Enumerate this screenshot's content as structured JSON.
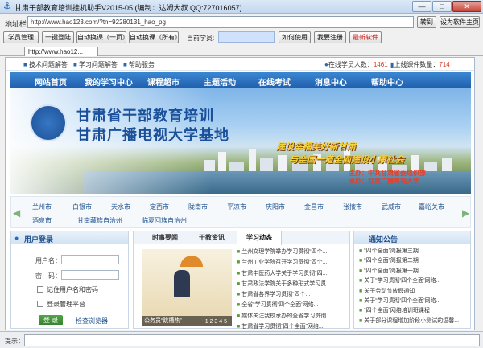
{
  "window": {
    "title": "甘肃干部教育培训挂机助手V2015-05 (编制：达姆大叔 QQ:727016057)",
    "minimize": "—",
    "maximize": "□",
    "close": "✕"
  },
  "address": {
    "label": "地址栏:",
    "value": "http://www.hao123.com/?tn=92280131_hao_pg",
    "go_button": "转到",
    "home_button": "设为软件主页"
  },
  "toolbar": {
    "student_mgmt": "学员管理",
    "one_click_login": "一键登陆",
    "auto_switch_page": "自动换课（一页）",
    "auto_switch_all": "自动换课（所有）",
    "current_student_label": "当前学员:",
    "current_student_value": "",
    "how_to_use": "如何使用",
    "register": "我要注册",
    "latest_software": "最新软件"
  },
  "tabs": [
    {
      "label": "http://www.hao12..."
    }
  ],
  "site": {
    "topline": {
      "links": [
        {
          "icon": "■",
          "label": "技术问题解答"
        },
        {
          "icon": "■",
          "label": "学习问题解答"
        },
        {
          "icon": "■",
          "label": "帮助服务"
        }
      ],
      "online_label": "在线学员人数：",
      "online_count": "1461",
      "courses_label": "上线课件数量：",
      "courses_count": "714"
    },
    "nav": [
      "网站首页",
      "我的学习中心",
      "课程超市",
      "主题活动",
      "在线考试",
      "消息中心",
      "帮助中心"
    ],
    "banner": {
      "title1": "甘肃省干部教育培训",
      "title2": "甘肃广播电视大学基地",
      "slogan1": "建设幸福美好新甘肃",
      "slogan2": "与全国一道全面建设小康社会",
      "host1": "主办：中共甘肃省委组织部",
      "host2": "承办：甘肃广播电视大学"
    },
    "cities_row1": [
      "兰州市",
      "白银市",
      "天水市",
      "定西市",
      "陇南市",
      "平凉市",
      "庆阳市",
      "金昌市",
      "张掖市",
      "武威市",
      "嘉峪关市"
    ],
    "cities_row2": [
      "酒泉市",
      "甘南藏族自治州",
      "临夏回族自治州"
    ],
    "login": {
      "title": "用户登录",
      "username_label": "用户名：",
      "password_label": "密　码：",
      "remember": "记住用户名和密码",
      "admin": "登录管理平台",
      "login_button": "登 录",
      "browser_check": "检查浏览器"
    },
    "news": {
      "tabs": [
        "时事要闻",
        "干教资讯",
        "学习动态"
      ],
      "active_tab": 2,
      "photo_caption": "公务员“跳槽热”",
      "photo_pager": "1 2 3 4 5",
      "items": [
        "兰州文理学院举办学习贯彻“四个...",
        "兰州工业学院召开学习贯彻“四个...",
        "甘肃中医药大学关于学习贯彻“四...",
        "甘肃政法学院关于多种形式学习贯...",
        "甘肃省各界学习贯彻“四个...",
        "全省“学习贯彻‘四个全面’网络...",
        "媒体关注我校承办的全省学习贯彻...",
        "甘肃省学习贯彻“四个全面”网络..."
      ]
    },
    "notice": {
      "title": "通知公告",
      "items": [
        "“四个全面”简报第三期",
        "“四个全面”简报第二期",
        "“四个全面”简报第一期",
        "关于“学习贯彻‘四个全面’网络...",
        "关于劳动节放假通知",
        "关于“学习贯彻‘四个全面’网络...",
        "“四个全面”网络培训班课程",
        "关于部分课程增加阶段小测试的温馨..."
      ]
    }
  },
  "status": {
    "label": "提示："
  }
}
